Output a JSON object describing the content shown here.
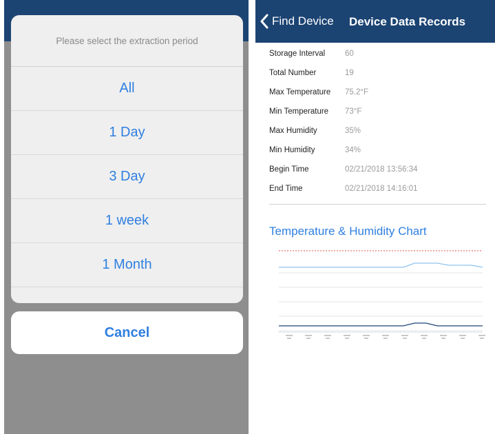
{
  "left_screen": {
    "sheet_title": "Please select the extraction period",
    "options": [
      "All",
      "1 Day",
      "3 Day",
      "1 week",
      "1 Month"
    ],
    "cancel_label": "Cancel"
  },
  "right_screen": {
    "nav": {
      "back_label": "Find Device",
      "title": "Device Data Records"
    },
    "records": [
      {
        "label": "Storage Interval",
        "value": "60"
      },
      {
        "label": "Total Number",
        "value": "19"
      },
      {
        "label": "Max Temperature",
        "value": "75.2°F"
      },
      {
        "label": "Min Temperature",
        "value": "73°F"
      },
      {
        "label": "Max Humidity",
        "value": "35%"
      },
      {
        "label": "Min Humidity",
        "value": "34%"
      },
      {
        "label": "Begin Time",
        "value": "02/21/2018 13:56:34"
      },
      {
        "label": "End Time",
        "value": "02/21/2018 14:16:01"
      }
    ],
    "chart_title": "Temperature & Humidity Chart"
  },
  "chart_data": {
    "type": "line",
    "title": "Temperature & Humidity Chart",
    "series": [
      {
        "values": [
          75.0,
          75.0,
          75.0,
          75.0,
          75.0,
          75.0,
          75.0,
          75.0,
          75.0,
          75.0,
          75.0,
          75.0,
          75.2,
          75.2,
          75.2,
          75.1,
          75.1,
          75.1,
          75.0
        ],
        "color": "#8fc3ee"
      },
      {
        "values": [
          34,
          34,
          34,
          34,
          34,
          34,
          34,
          34,
          34,
          34,
          34,
          34,
          35,
          35,
          34,
          34,
          34,
          34,
          34
        ],
        "color": "#1c4473"
      }
    ],
    "colors": {
      "limit_line": "#e05050",
      "grid": "#e6e6e6"
    }
  }
}
